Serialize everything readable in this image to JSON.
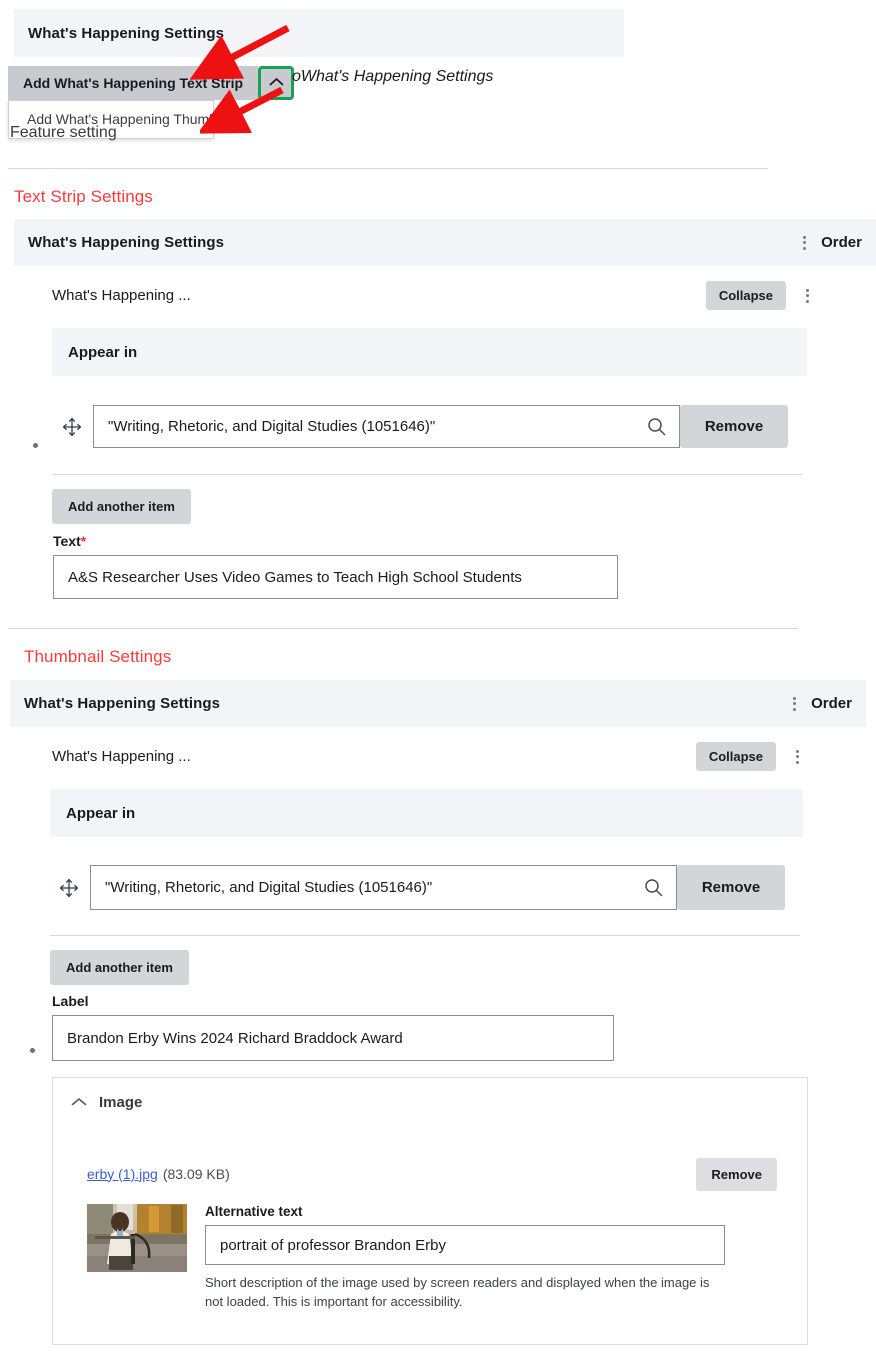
{
  "top": {
    "header_title": "What's Happening Settings",
    "dropdown_button_label": "Add What's Happening Text Strip",
    "dropdown_toggle_icon": "chevron-up-icon",
    "dropdown_menu_items": [
      "Add What's Happening Thumbnail"
    ],
    "side_note": "oWhat's Happening Settings",
    "feature_setting_text": "Feature setting"
  },
  "text_strip": {
    "section_heading": "Text Strip Settings",
    "band_title": "What's Happening Settings",
    "order_label": "Order",
    "item_title": "What's Happening ...",
    "collapse_label": "Collapse",
    "appear_in_label": "Appear in",
    "search_value": "\"Writing, Rhetoric, and Digital Studies (1051646)\"",
    "search_icon": "search-icon",
    "remove_label": "Remove",
    "add_another_label": "Add another item",
    "text_label": "Text",
    "text_required_marker": "*",
    "text_value": "A&S Researcher Uses Video Games to Teach High School Students"
  },
  "thumbnail": {
    "section_heading": "Thumbnail Settings",
    "band_title": "What's Happening Settings",
    "order_label": "Order",
    "item_title": "What's Happening ...",
    "collapse_label": "Collapse",
    "appear_in_label": "Appear in",
    "search_value": "\"Writing, Rhetoric, and Digital Studies (1051646)\"",
    "search_icon": "search-icon",
    "remove_label": "Remove",
    "add_another_label": "Add another item",
    "label_label": "Label",
    "label_value": "Brandon Erby Wins 2024 Richard Braddock Award",
    "image_panel": {
      "title": "Image",
      "collapse_icon": "chevron-up-icon",
      "file_name": "erby (1).jpg",
      "file_size": "(83.09 KB)",
      "remove_label": "Remove",
      "thumbnail_alt": "portrait of professor Brandon Erby",
      "alt_text_label": "Alternative text",
      "alt_text_value": "portrait of professor Brandon Erby",
      "alt_help_text": "Short description of the image used by screen readers and displayed when the image is not loaded. This is important for accessibility."
    }
  },
  "colors": {
    "section_heading_red": "#fb3b3b",
    "band_bg": "#f3f4f8",
    "button_grey": "#d4d5d9",
    "annotation_red": "#ee1111",
    "annotation_green": "#18a05a",
    "link_blue": "#3b5ed0"
  }
}
